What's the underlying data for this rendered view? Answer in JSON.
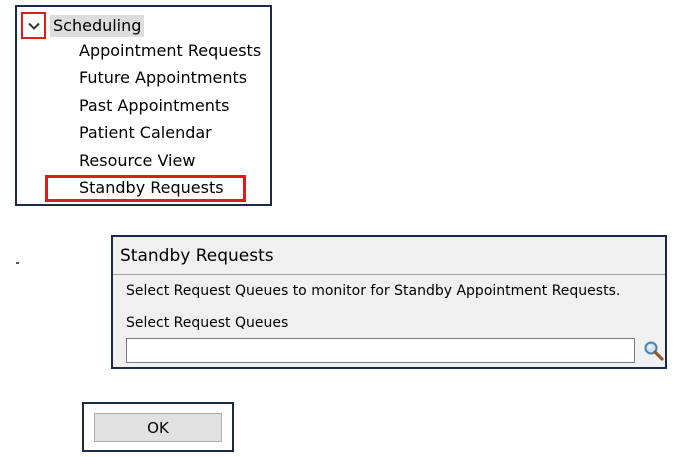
{
  "tree": {
    "root_label": "Scheduling",
    "toggle_icon": "chevron-down-icon",
    "items": [
      {
        "label": "Appointment Requests"
      },
      {
        "label": "Future Appointments"
      },
      {
        "label": "Past Appointments"
      },
      {
        "label": "Patient Calendar"
      },
      {
        "label": "Resource View"
      },
      {
        "label": "Standby Requests",
        "highlighted": true
      }
    ],
    "highlight_color": "#e01b1b"
  },
  "dialog": {
    "title": "Standby Requests",
    "description": "Select Request Queues to monitor for Standby Appointment Requests.",
    "field_label": "Select Request Queues",
    "field_value": "",
    "search_icon": "magnifier-icon"
  },
  "ok_button": {
    "label": "OK"
  },
  "colors": {
    "frame_border": "#1c2a4a",
    "annotation_red": "#e01b1b",
    "dialog_bg": "#f0f0f0",
    "selected_bg": "#dcdcdc"
  }
}
